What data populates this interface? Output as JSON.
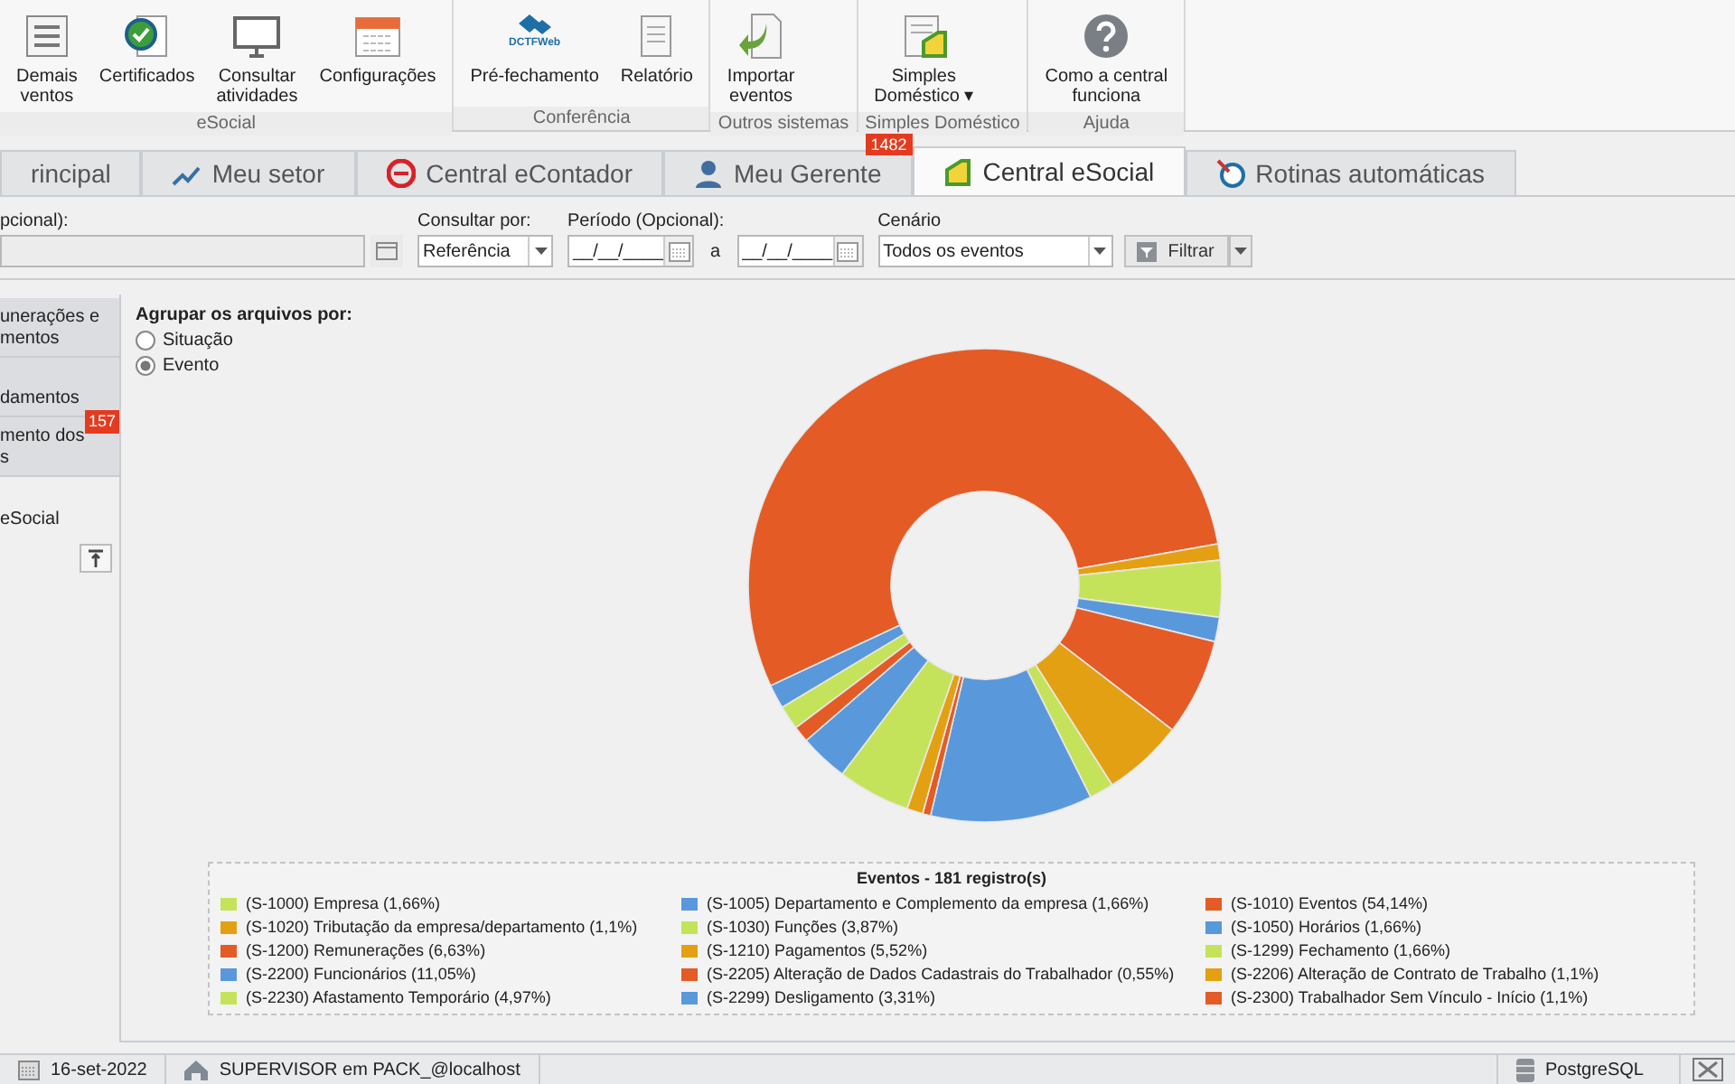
{
  "ribbon": {
    "groups": [
      {
        "label": "eSocial",
        "buttons": [
          {
            "lines": [
              "Demais",
              "ventos"
            ]
          },
          {
            "lines": [
              "Certificados"
            ]
          },
          {
            "lines": [
              "Consultar",
              "atividades"
            ]
          },
          {
            "lines": [
              "Configurações"
            ]
          }
        ]
      },
      {
        "label": "Conferência",
        "buttons": [
          {
            "lines": [
              "Pré-fechamento"
            ],
            "logo_text": "DCTFWeb"
          },
          {
            "lines": [
              "Relatório"
            ]
          }
        ]
      },
      {
        "label": "Outros sistemas",
        "buttons": [
          {
            "lines": [
              "Importar",
              "eventos"
            ]
          }
        ]
      },
      {
        "label": "Simples Doméstico",
        "buttons": [
          {
            "lines": [
              "Simples",
              "Doméstico ▾"
            ]
          }
        ]
      },
      {
        "label": "Ajuda",
        "buttons": [
          {
            "lines": [
              "Como a central",
              "funciona"
            ]
          }
        ]
      }
    ]
  },
  "tabs": [
    {
      "label": "rincipal",
      "selected": false
    },
    {
      "label": "Meu setor",
      "selected": false
    },
    {
      "label": "Central eContador",
      "selected": false
    },
    {
      "label": "Meu Gerente",
      "selected": false,
      "badge": "1482"
    },
    {
      "label": "Central eSocial",
      "selected": true
    },
    {
      "label": "Rotinas automáticas",
      "selected": false
    }
  ],
  "filters": {
    "field_1": {
      "label": "pcional):"
    },
    "consultar_por": {
      "label": "Consultar por:",
      "value": "Referência"
    },
    "periodo": {
      "label": "Período (Opcional):",
      "from": "__/__/____",
      "separator": "a",
      "to": "__/__/____"
    },
    "cenario": {
      "label": "Cenário",
      "value": "Todos os eventos"
    },
    "filter_button": "Filtrar"
  },
  "sidebar": {
    "items": [
      {
        "lines": [
          "unerações e",
          "mentos"
        ],
        "selected": false
      },
      {
        "lines": [
          "damentos"
        ],
        "selected": false
      },
      {
        "lines": [
          "mento dos",
          "s"
        ],
        "selected": false,
        "badge": "157"
      },
      {
        "lines": [
          "eSocial"
        ],
        "selected": true
      }
    ]
  },
  "group_by": {
    "label": "Agrupar os arquivos por:",
    "options": [
      {
        "label": "Situação",
        "selected": false
      },
      {
        "label": "Evento",
        "selected": true
      }
    ]
  },
  "chart_data": {
    "type": "donut",
    "title": "Eventos - 181 registro(s)",
    "categories": [
      "(S-1000) Empresa (1,66%)",
      "(S-1005) Departamento e Complemento da empresa (1,66%)",
      "(S-1010) Eventos (54,14%)",
      "(S-1020) Tributação da empresa/departamento (1,1%)",
      "(S-1030) Funções (3,87%)",
      "(S-1050) Horários (1,66%)",
      "(S-1200) Remunerações (6,63%)",
      "(S-1210) Pagamentos (5,52%)",
      "(S-1299) Fechamento (1,66%)",
      "(S-2200) Funcionários (11,05%)",
      "(S-2205) Alteração de Dados Cadastrais do Trabalhador (0,55%)",
      "(S-2206) Alteração de Contrato de Trabalho (1,1%)",
      "(S-2230) Afastamento Temporário (4,97%)",
      "(S-2299) Desligamento (3,31%)",
      "(S-2300) Trabalhador Sem Vínculo - Início (1,1%)"
    ],
    "values": [
      1.66,
      1.66,
      54.14,
      1.1,
      3.87,
      1.66,
      6.63,
      5.52,
      1.66,
      11.05,
      0.55,
      1.1,
      4.97,
      3.31,
      1.1
    ],
    "colors": [
      "#c5e35a",
      "#5a98dc",
      "#e45b26",
      "#e4a013",
      "#c5e35a",
      "#5a98dc",
      "#e45b26",
      "#e4a013",
      "#c5e35a",
      "#5a98dc",
      "#e45b26",
      "#e4a013",
      "#c5e35a",
      "#5a98dc",
      "#e45b26"
    ]
  },
  "status_bar": {
    "date": "16-set-2022",
    "user": "SUPERVISOR em PACK_@localhost",
    "database": "PostgreSQL"
  }
}
